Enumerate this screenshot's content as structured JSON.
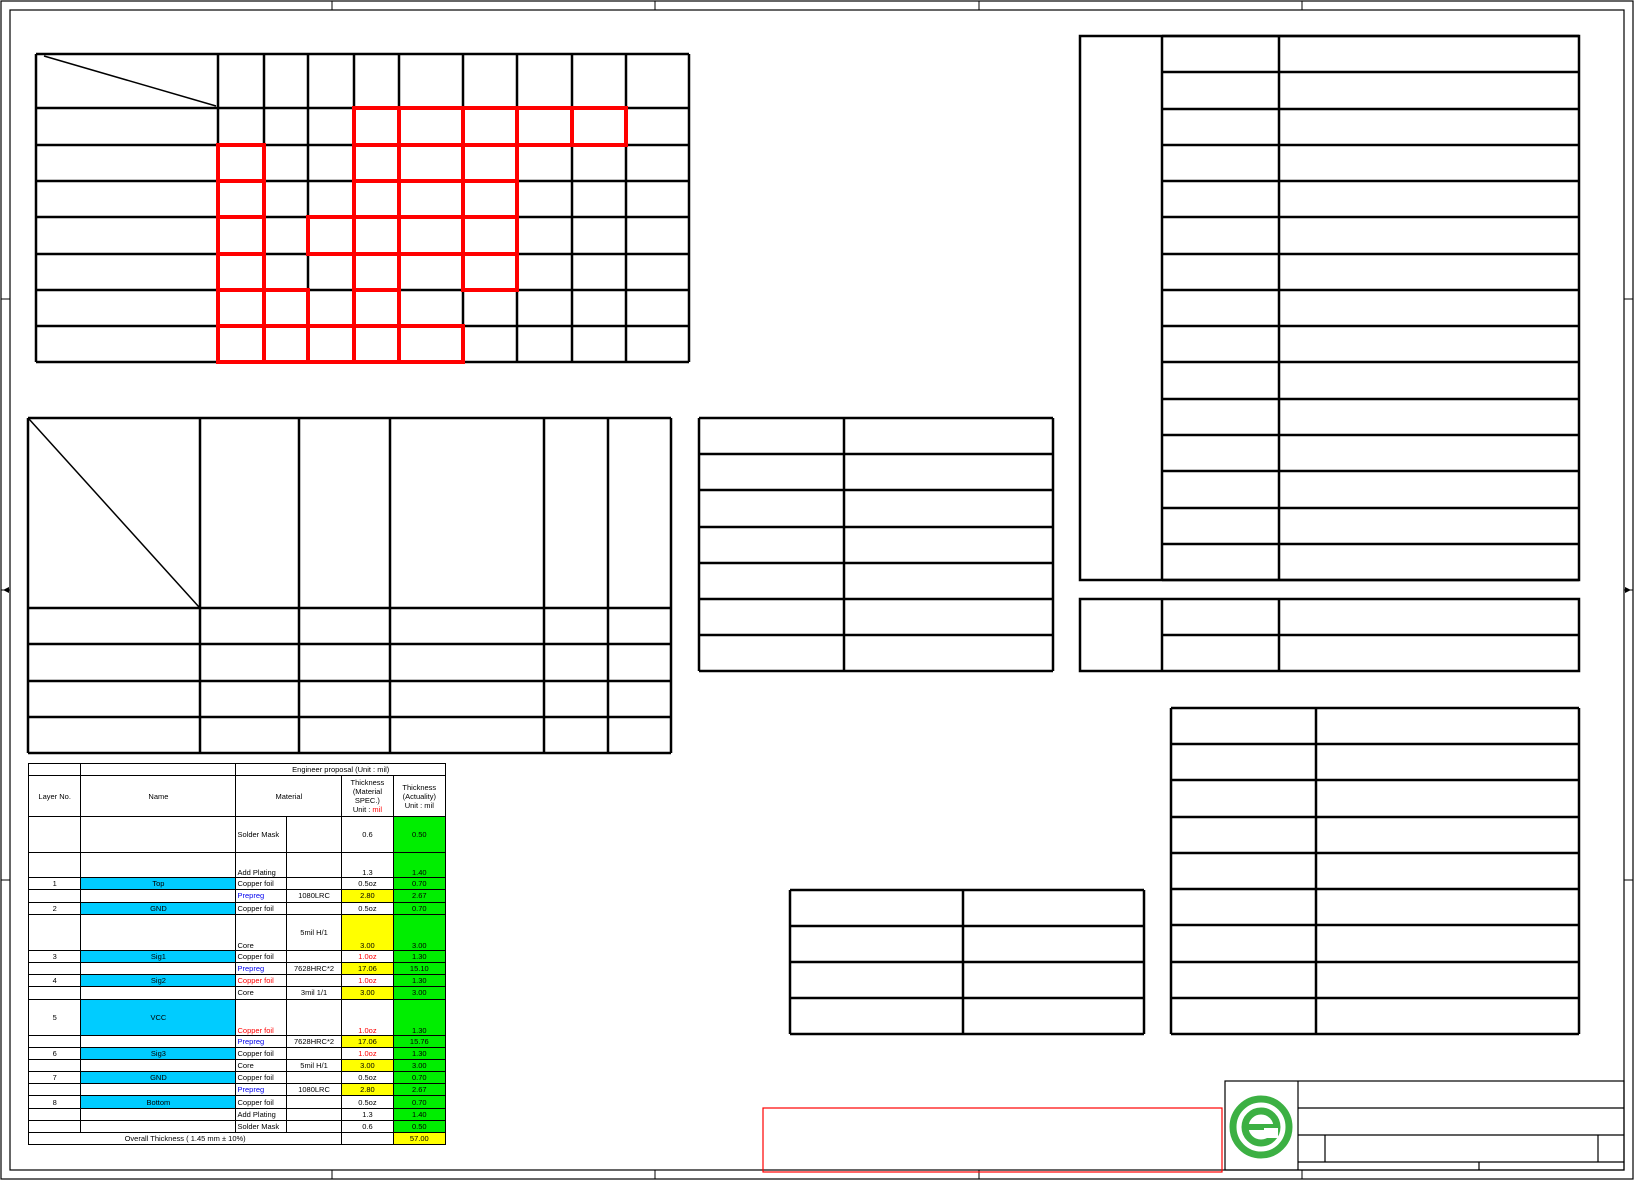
{
  "colors": {
    "frame": "#000000",
    "highlight": "#ff0000",
    "layer_name_fill": "#00ccff",
    "material_fill": "#ffff00",
    "actual_fill": "#00ee00",
    "prepreg_text": "#0000ee",
    "inner_copper_text": "#ff0000",
    "logo_green": "#3cb043"
  },
  "icons": {
    "logo": "company-logo-icon"
  },
  "stackup": {
    "header": {
      "layer_no": "Layer No.",
      "name": "Name",
      "group": "Engineer proposal (Unit : mil)",
      "material": "Material",
      "thickness_spec_line1": "Thickness",
      "thickness_spec_line2": "(Material",
      "thickness_spec_line3": "SPEC.)",
      "thickness_spec_unit_prefix": "Unit :",
      "thickness_spec_unit": "mil",
      "thickness_actual_line1": "Thickness",
      "thickness_actual_line2": "(Actuality)",
      "thickness_actual_unit": "Unit : mil"
    },
    "rows": [
      {
        "layer": "",
        "name": "",
        "material": "Solder Mask",
        "spec": "",
        "thk": "0.6",
        "act": "0.50",
        "kind": "mask"
      },
      {
        "layer": "",
        "name": "",
        "material": "Add Plating",
        "spec": "",
        "thk": "1.3",
        "act": "1.40",
        "kind": "plating"
      },
      {
        "layer": "1",
        "name": "Top",
        "material": "Copper foil",
        "spec": "",
        "thk": "0.5oz",
        "act": "0.70",
        "kind": "copper"
      },
      {
        "layer": "",
        "name": "",
        "material": "Prepreg",
        "spec": "1080LRC",
        "thk": "2.80",
        "act": "2.67",
        "kind": "prepreg"
      },
      {
        "layer": "2",
        "name": "GND",
        "material": "Copper foil",
        "spec": "",
        "thk": "0.5oz",
        "act": "0.70",
        "kind": "copper"
      },
      {
        "layer": "",
        "name": "",
        "material": "Core",
        "spec": "5mil H/1",
        "thk": "3.00",
        "act": "3.00",
        "kind": "core-tall"
      },
      {
        "layer": "3",
        "name": "Sig1",
        "material": "Copper foil",
        "spec": "",
        "thk": "1.0oz",
        "act": "1.30",
        "kind": "copper-red-thk"
      },
      {
        "layer": "",
        "name": "",
        "material": "Prepreg",
        "spec": "7628HRC*2",
        "thk": "17.06",
        "act": "15.10",
        "kind": "prepreg"
      },
      {
        "layer": "4",
        "name": "Sig2",
        "material": "Copper foil",
        "spec": "",
        "thk": "1.0oz",
        "act": "1.30",
        "kind": "copper-red"
      },
      {
        "layer": "",
        "name": "",
        "material": "Core",
        "spec": "3mil 1/1",
        "thk": "3.00",
        "act": "3.00",
        "kind": "core"
      },
      {
        "layer": "5",
        "name": "VCC",
        "material": "Copper foil",
        "spec": "",
        "thk": "1.0oz",
        "act": "1.30",
        "kind": "copper-red-tall"
      },
      {
        "layer": "",
        "name": "",
        "material": "Prepreg",
        "spec": "7628HRC*2",
        "thk": "17.06",
        "act": "15.76",
        "kind": "prepreg"
      },
      {
        "layer": "6",
        "name": "Sig3",
        "material": "Copper foil",
        "spec": "",
        "thk": "1.0oz",
        "act": "1.30",
        "kind": "copper-red-thk"
      },
      {
        "layer": "",
        "name": "",
        "material": "Core",
        "spec": "5mil H/1",
        "thk": "3.00",
        "act": "3.00",
        "kind": "core"
      },
      {
        "layer": "7",
        "name": "GND",
        "material": "Copper foil",
        "spec": "",
        "thk": "0.5oz",
        "act": "0.70",
        "kind": "copper"
      },
      {
        "layer": "",
        "name": "",
        "material": "Prepreg",
        "spec": "1080LRC",
        "thk": "2.80",
        "act": "2.67",
        "kind": "prepreg"
      },
      {
        "layer": "8",
        "name": "Bottom",
        "material": "Copper foil",
        "spec": "",
        "thk": "0.5oz",
        "act": "0.70",
        "kind": "copper"
      },
      {
        "layer": "",
        "name": "",
        "material": "Add Plating",
        "spec": "",
        "thk": "1.3",
        "act": "1.40",
        "kind": "plain"
      },
      {
        "layer": "",
        "name": "",
        "material": "Solder Mask",
        "spec": "",
        "thk": "0.6",
        "act": "0.50",
        "kind": "plain"
      }
    ],
    "overall_label": "Overall Thickness ( 1.45 mm ± 10%)",
    "overall_value": "57.00"
  }
}
